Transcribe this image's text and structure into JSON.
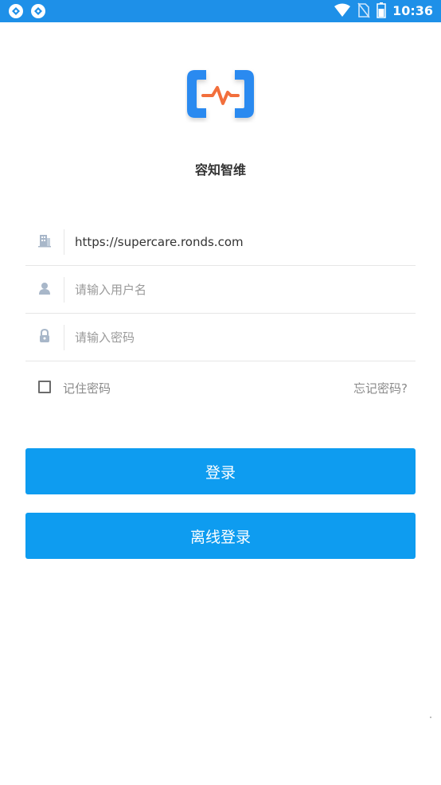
{
  "status_bar": {
    "time": "10:36",
    "icons": [
      "app-notification-icon",
      "app-notification-icon",
      "wifi-icon",
      "no-sim-icon",
      "battery-icon"
    ]
  },
  "app": {
    "name": "容知智维",
    "logo_icon": "heartbeat-bracket-logo",
    "colors": {
      "logo_blue": "#2c8af0",
      "logo_pulse": "#f26f3c",
      "primary": "#0e9cf0"
    }
  },
  "form": {
    "server_field": {
      "icon": "building-icon",
      "value": "https://supercare.ronds.com",
      "placeholder": ""
    },
    "username_field": {
      "icon": "user-icon",
      "value": "",
      "placeholder": "请输入用户名"
    },
    "password_field": {
      "icon": "lock-icon",
      "value": "",
      "placeholder": "请输入密码"
    },
    "remember_label": "记住密码",
    "forgot_label": "忘记密码?"
  },
  "buttons": {
    "login_label": "登录",
    "offline_login_label": "离线登录"
  }
}
